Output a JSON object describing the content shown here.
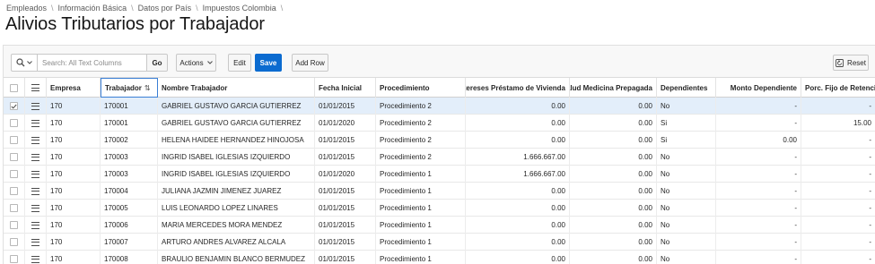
{
  "breadcrumb": [
    "Empleados",
    "Información Básica",
    "Datos por País",
    "Impuestos Colombia"
  ],
  "page_title": "Alivios Tributarios por Trabajador",
  "toolbar": {
    "search_placeholder": "Search: All Text Columns",
    "go_label": "Go",
    "actions_label": "Actions",
    "edit_label": "Edit",
    "save_label": "Save",
    "add_row_label": "Add Row",
    "reset_label": "Reset"
  },
  "colors": {
    "accent": "#0b6bd0",
    "selected_row": "#e3eefa"
  },
  "columns": [
    "Empresa",
    "Trabajador",
    "Nombre Trabajador",
    "Fecha Inicial",
    "Procedimiento",
    "Intereses Préstamo de Vivienda",
    "Salud Medicina Prepagada",
    "Dependientes",
    "Monto Dependiente",
    "Porc. Fijo de Retención"
  ],
  "sort_indicator": "⇅",
  "rows": [
    {
      "selected": true,
      "empresa": "170",
      "trabajador": "170001",
      "nombre": "GABRIEL GUSTAVO GARCIA GUTIERREZ",
      "fecha": "01/01/2015",
      "procedimiento": "Procedimiento 2",
      "intereses": "0.00",
      "salud": "0.00",
      "dependientes": "No",
      "monto": "-",
      "porc": "-"
    },
    {
      "selected": false,
      "empresa": "170",
      "trabajador": "170001",
      "nombre": "GABRIEL GUSTAVO GARCIA GUTIERREZ",
      "fecha": "01/01/2020",
      "procedimiento": "Procedimiento 2",
      "intereses": "0.00",
      "salud": "0.00",
      "dependientes": "Si",
      "monto": "-",
      "porc": "15.00"
    },
    {
      "selected": false,
      "empresa": "170",
      "trabajador": "170002",
      "nombre": "HELENA HAIDEE HERNANDEZ HINOJOSA",
      "fecha": "01/01/2015",
      "procedimiento": "Procedimiento 2",
      "intereses": "0.00",
      "salud": "0.00",
      "dependientes": "Si",
      "monto": "0.00",
      "porc": "-"
    },
    {
      "selected": false,
      "empresa": "170",
      "trabajador": "170003",
      "nombre": "INGRID ISABEL IGLESIAS IZQUIERDO",
      "fecha": "01/01/2015",
      "procedimiento": "Procedimiento 2",
      "intereses": "1.666.667.00",
      "salud": "0.00",
      "dependientes": "No",
      "monto": "-",
      "porc": "-"
    },
    {
      "selected": false,
      "empresa": "170",
      "trabajador": "170003",
      "nombre": "INGRID ISABEL IGLESIAS IZQUIERDO",
      "fecha": "01/01/2020",
      "procedimiento": "Procedimiento 1",
      "intereses": "1.666.667.00",
      "salud": "0.00",
      "dependientes": "No",
      "monto": "-",
      "porc": "-"
    },
    {
      "selected": false,
      "empresa": "170",
      "trabajador": "170004",
      "nombre": "JULIANA JAZMIN JIMENEZ JUAREZ",
      "fecha": "01/01/2015",
      "procedimiento": "Procedimiento 1",
      "intereses": "0.00",
      "salud": "0.00",
      "dependientes": "No",
      "monto": "-",
      "porc": "-"
    },
    {
      "selected": false,
      "empresa": "170",
      "trabajador": "170005",
      "nombre": "LUIS LEONARDO LOPEZ LINARES",
      "fecha": "01/01/2015",
      "procedimiento": "Procedimiento 1",
      "intereses": "0.00",
      "salud": "0.00",
      "dependientes": "No",
      "monto": "-",
      "porc": "-"
    },
    {
      "selected": false,
      "empresa": "170",
      "trabajador": "170006",
      "nombre": "MARIA MERCEDES MORA MENDEZ",
      "fecha": "01/01/2015",
      "procedimiento": "Procedimiento 1",
      "intereses": "0.00",
      "salud": "0.00",
      "dependientes": "No",
      "monto": "-",
      "porc": "-"
    },
    {
      "selected": false,
      "empresa": "170",
      "trabajador": "170007",
      "nombre": "ARTURO ANDRES ALVAREZ ALCALA",
      "fecha": "01/01/2015",
      "procedimiento": "Procedimiento 1",
      "intereses": "0.00",
      "salud": "0.00",
      "dependientes": "No",
      "monto": "-",
      "porc": "-"
    },
    {
      "selected": false,
      "empresa": "170",
      "trabajador": "170008",
      "nombre": "BRAULIO BENJAMIN BLANCO BERMUDEZ",
      "fecha": "01/01/2015",
      "procedimiento": "Procedimiento 1",
      "intereses": "0.00",
      "salud": "0.00",
      "dependientes": "No",
      "monto": "-",
      "porc": "-"
    }
  ]
}
